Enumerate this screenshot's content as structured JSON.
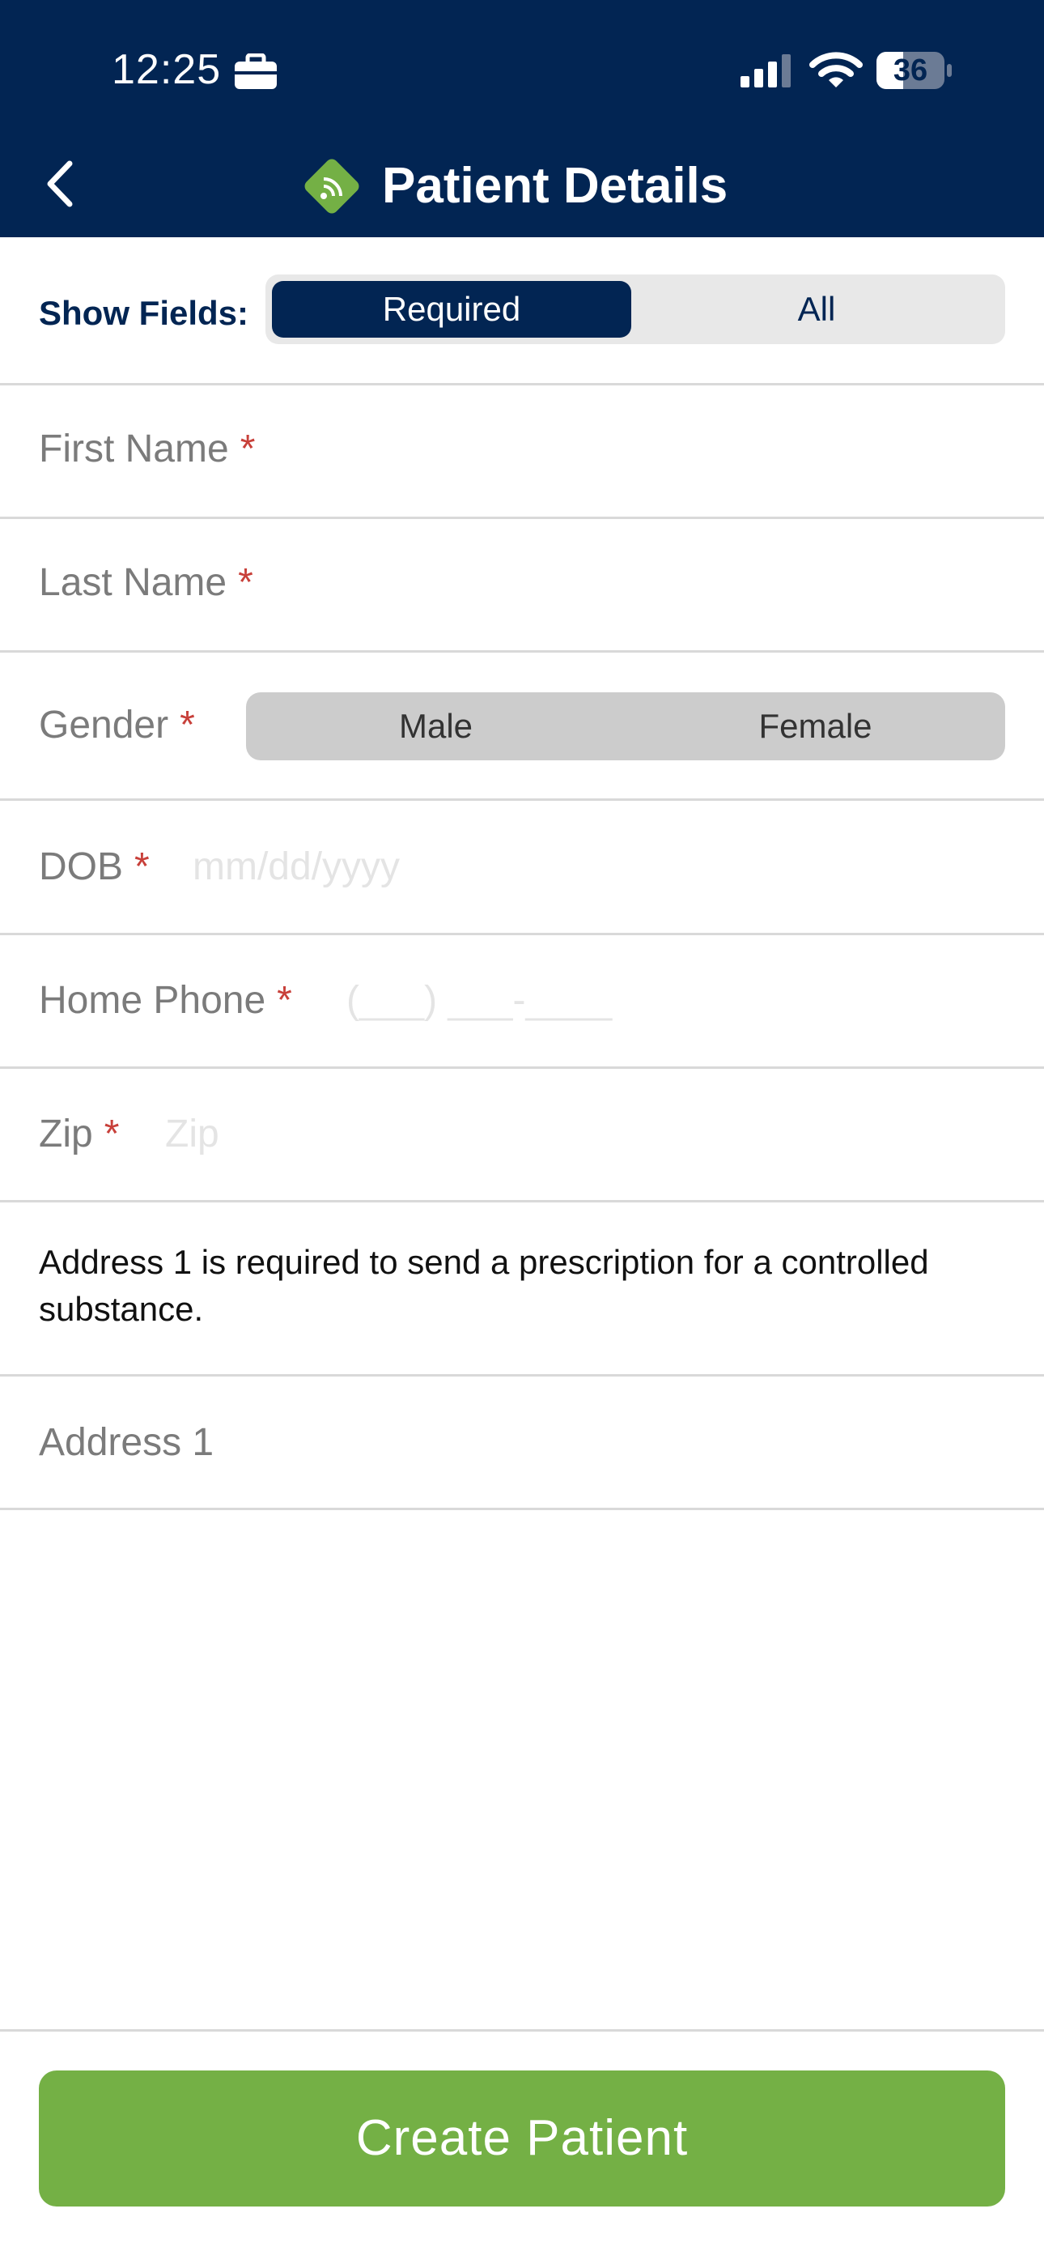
{
  "status_bar": {
    "time": "12:25",
    "battery": "36",
    "icons": [
      "briefcase-icon",
      "cellular-signal-icon",
      "wifi-icon",
      "battery-icon"
    ]
  },
  "header": {
    "title": "Patient Details",
    "back_icon": "chevron-left-icon",
    "logo_icon": "green-diamond-rx-logo"
  },
  "show_fields": {
    "label": "Show Fields:",
    "options": [
      "Required",
      "All"
    ],
    "selected": "Required"
  },
  "form": {
    "first_name": {
      "label": "First Name",
      "required_mark": "*"
    },
    "last_name": {
      "label": "Last Name",
      "required_mark": "*"
    },
    "gender": {
      "label": "Gender",
      "required_mark": "*",
      "options": [
        "Male",
        "Female"
      ]
    },
    "dob": {
      "label": "DOB",
      "required_mark": "*",
      "placeholder": "mm/dd/yyyy"
    },
    "home_phone": {
      "label": "Home Phone",
      "required_mark": "*",
      "placeholder": "(___) ___-____"
    },
    "zip": {
      "label": "Zip",
      "required_mark": "*",
      "placeholder": "Zip"
    },
    "address_note": "Address 1 is required to send a prescription for a controlled substance.",
    "address1": {
      "label": "Address 1"
    }
  },
  "footer": {
    "create_label": "Create Patient"
  },
  "colors": {
    "header_bg": "#022553",
    "accent_green": "#74b045",
    "required_red": "#c8403a"
  }
}
